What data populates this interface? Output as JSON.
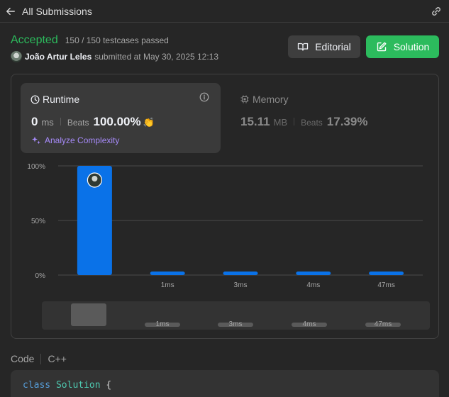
{
  "header": {
    "back_label": "All Submissions"
  },
  "submission": {
    "status": "Accepted",
    "testcases": "150 / 150 testcases passed",
    "author": "João Artur Leles",
    "submitted_at": "submitted at May 30, 2025 12:13"
  },
  "buttons": {
    "editorial": "Editorial",
    "solution": "Solution"
  },
  "runtime": {
    "title": "Runtime",
    "value": "0",
    "unit": "ms",
    "beats_label": "Beats",
    "beats_value": "100.00%",
    "analyze_label": "Analyze Complexity"
  },
  "memory": {
    "title": "Memory",
    "value": "15.11",
    "unit": "MB",
    "beats_label": "Beats",
    "beats_value": "17.39%"
  },
  "chart_data": {
    "type": "bar",
    "categories": [
      "",
      "1ms",
      "3ms",
      "4ms",
      "47ms"
    ],
    "values": [
      100,
      3,
      3,
      3,
      3
    ],
    "ylim": [
      0,
      100
    ],
    "yticks": [
      "100%",
      "50%",
      "0%"
    ],
    "grid": true,
    "highlight_index": 0
  },
  "minimap": {
    "labels": [
      "1ms",
      "3ms",
      "4ms",
      "47ms"
    ]
  },
  "code": {
    "label": "Code",
    "language": "C++",
    "first_line_keyword": "class",
    "first_line_name": "Solution",
    "first_line_punct": " {"
  },
  "colors": {
    "accent_green": "#2cbb5d",
    "bar_blue": "#0a72e8",
    "purple": "#a78bfa"
  },
  "icons": [
    "arrow-left-icon",
    "link-icon",
    "book-icon",
    "edit-icon",
    "clock-icon",
    "info-icon",
    "sparkle-icon",
    "chip-icon",
    "clap-icon",
    "avatar"
  ]
}
